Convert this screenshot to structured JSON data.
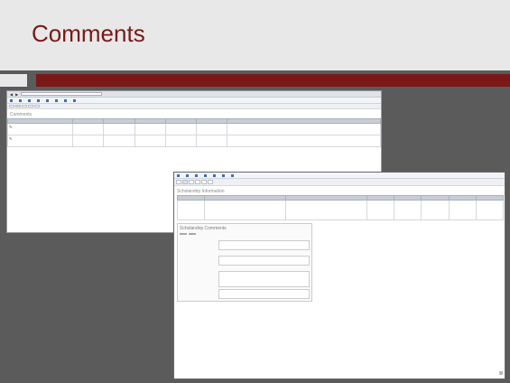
{
  "slide": {
    "title": "Comments"
  },
  "colors": {
    "title": "#7b1818",
    "band": "#7b1818",
    "background": "#5b5b5b"
  },
  "shot1": {
    "url": "",
    "bookmarks": [
      "",
      "",
      "",
      "",
      "",
      "",
      "",
      "",
      "",
      "",
      "",
      "",
      "",
      "",
      ""
    ],
    "nav_tabs": [
      "",
      "",
      "",
      "",
      "",
      ""
    ],
    "breadcrumb": "",
    "heading": "Comments",
    "columns": [
      "",
      "",
      "",
      "",
      "",
      "",
      ""
    ],
    "rows": [
      {
        "c": [
          "",
          "",
          "",
          "",
          "",
          "",
          ""
        ]
      },
      {
        "c": [
          "",
          "",
          "",
          "",
          "",
          "",
          ""
        ]
      }
    ]
  },
  "shot2": {
    "bookmarks": [
      "",
      "",
      "",
      "",
      "",
      "",
      "",
      "",
      "",
      "",
      "",
      "",
      "",
      ""
    ],
    "nav_tabs": [
      "",
      "",
      "",
      "",
      "",
      "",
      ""
    ],
    "breadcrumb": "",
    "heading": "Scholarship Information",
    "columns": [
      "",
      "",
      "",
      "",
      "",
      "",
      "",
      ""
    ],
    "row": [
      "",
      "",
      "",
      "",
      "",
      "",
      "",
      ""
    ],
    "comments_heading": "Scholarship Comments",
    "buttons": [
      "",
      ""
    ],
    "comments": [
      {
        "code_label": "",
        "field_label": "",
        "text": ""
      },
      {
        "code_label": "",
        "field_label": "",
        "text": ""
      },
      {
        "code_label": "",
        "field_label": "",
        "text": ""
      }
    ],
    "extra_field_label": ""
  }
}
